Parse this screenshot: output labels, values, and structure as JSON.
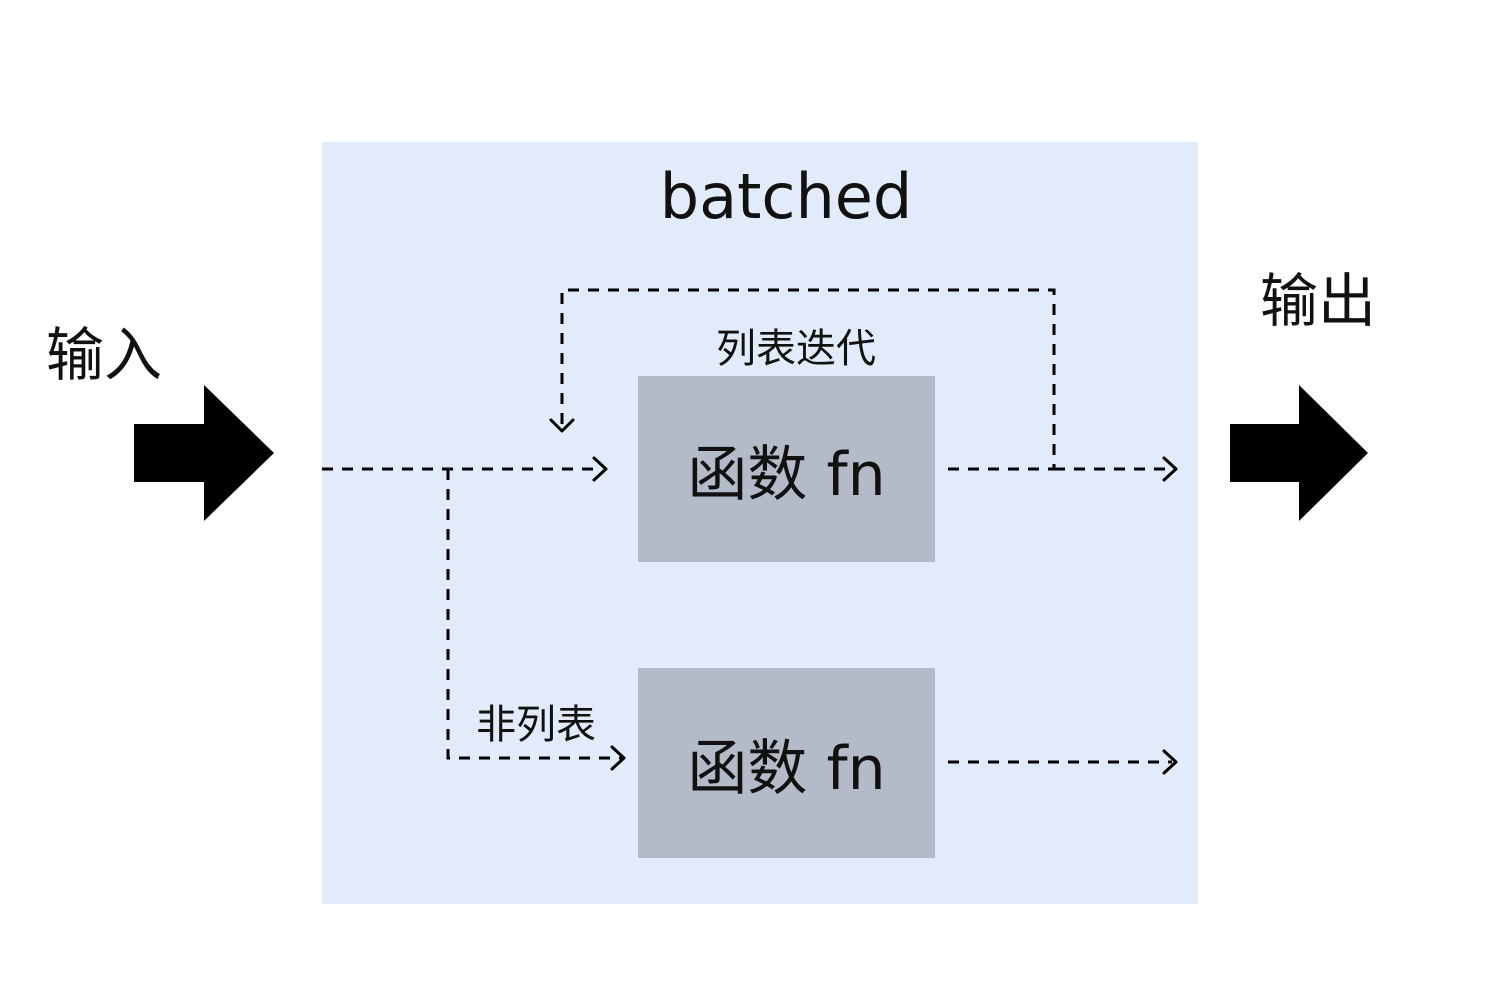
{
  "diagram": {
    "container_title": "batched",
    "input_label": "输入",
    "output_label": "输出",
    "function_box_top": "函数 fn",
    "function_box_bottom": "函数 fn",
    "iterate_label": "列表迭代",
    "non_list_label": "非列表"
  },
  "colors": {
    "container_fill": "#e1ebfa",
    "function_box_fill": "#b4bbc8",
    "arrow_fill": "#000000",
    "dashed_line": "#000000"
  },
  "icons": {
    "input_arrow": "right-arrow-icon",
    "output_arrow": "right-arrow-icon"
  }
}
